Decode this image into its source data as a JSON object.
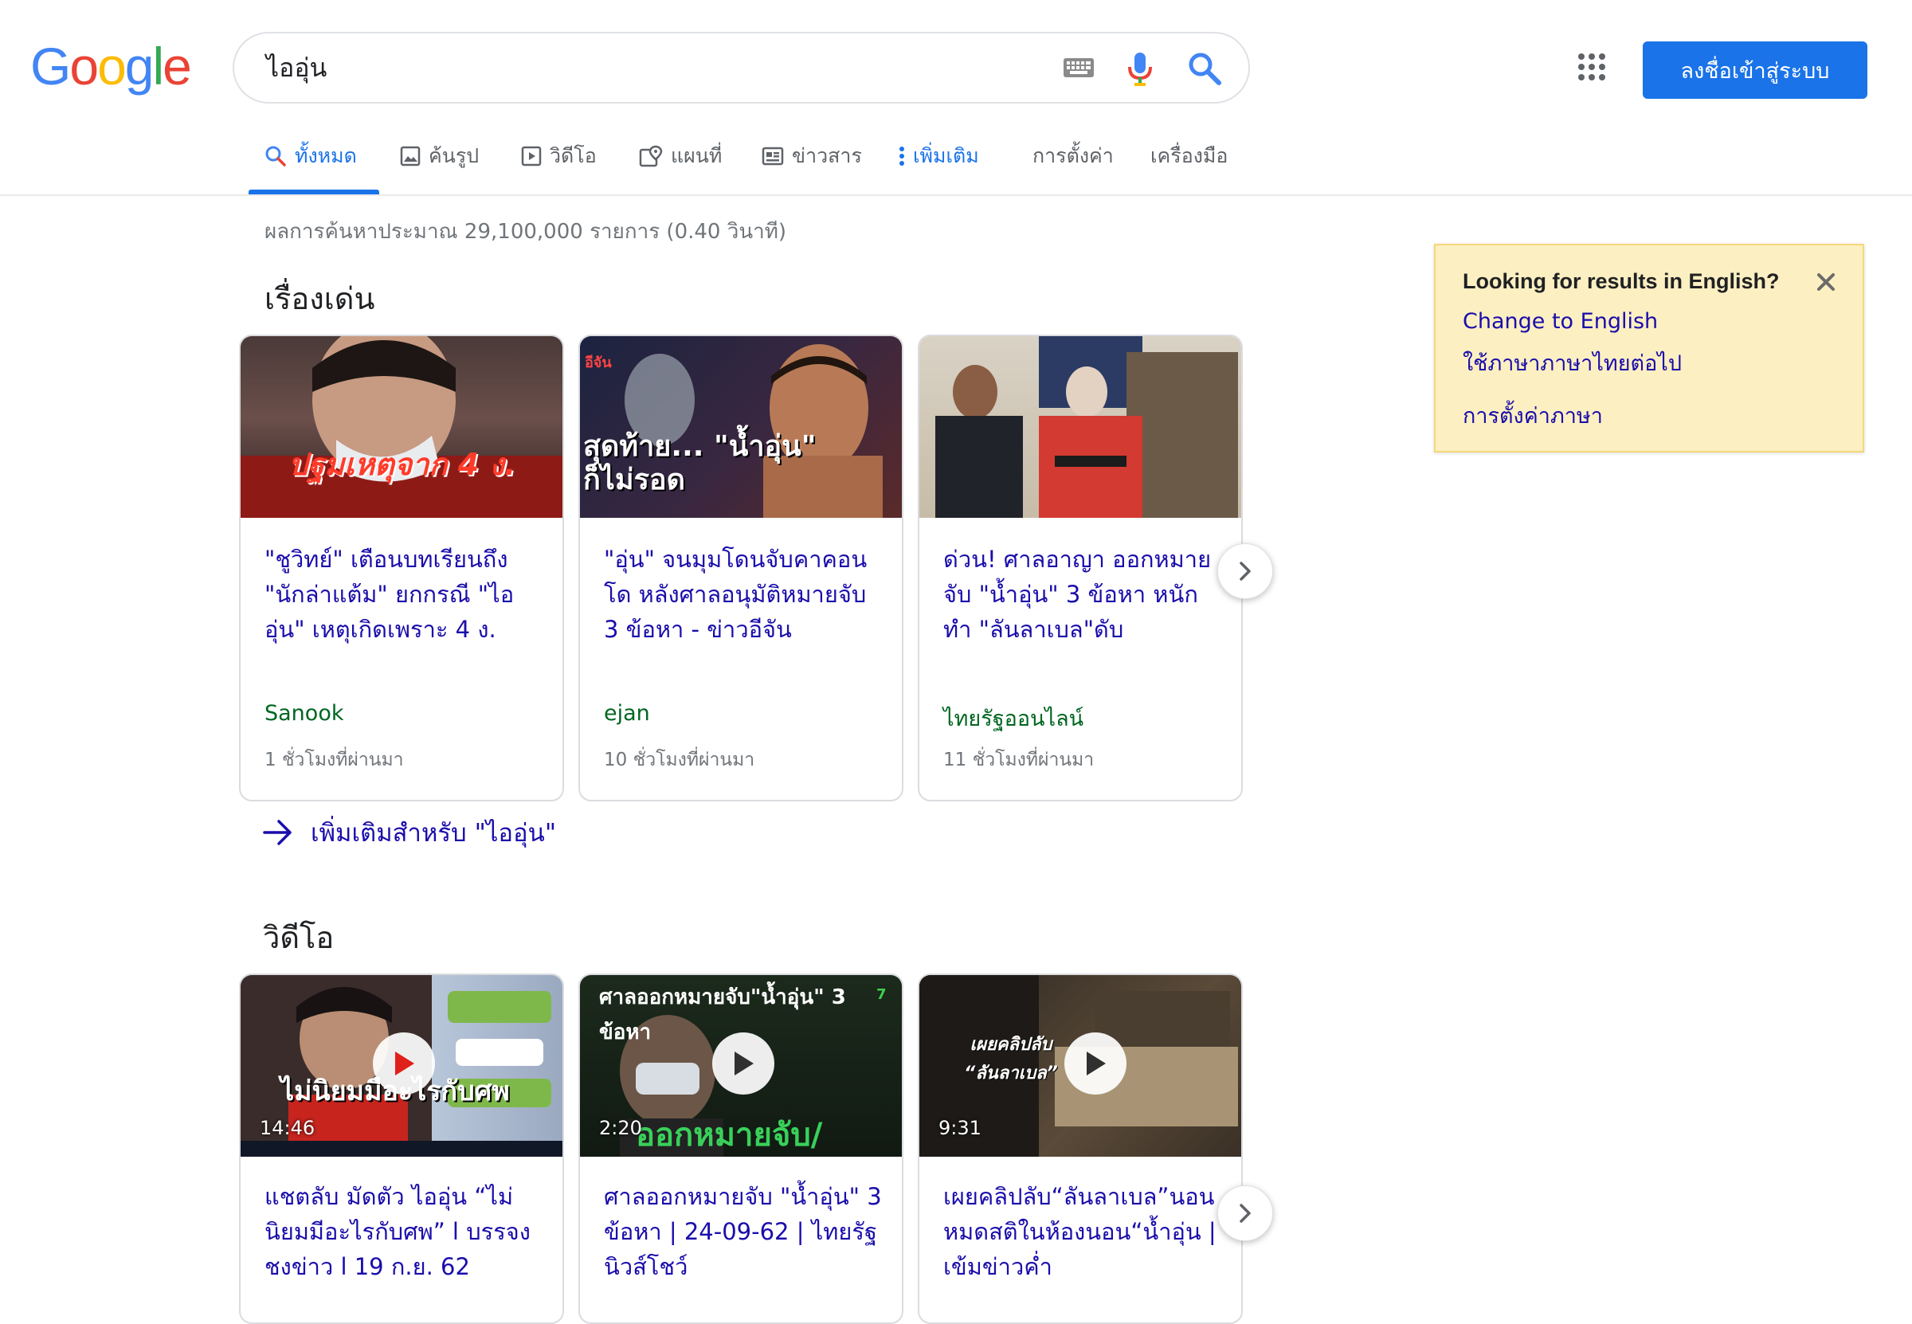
{
  "search": {
    "query": "ไออุ่น"
  },
  "logo": {
    "letters": [
      "G",
      "o",
      "o",
      "g",
      "l",
      "e"
    ],
    "colors": [
      "#4285F4",
      "#EA4335",
      "#FBBC05",
      "#4285F4",
      "#34A853",
      "#EA4335"
    ]
  },
  "header": {
    "signin_label": "ลงชื่อเข้าสู่ระบบ"
  },
  "tabs": [
    {
      "label": "ทั้งหมด",
      "icon": "search-icon",
      "active": true
    },
    {
      "label": "ค้นรูป",
      "icon": "image-icon"
    },
    {
      "label": "วิดีโอ",
      "icon": "video-icon"
    },
    {
      "label": "แผนที่",
      "icon": "map-icon"
    },
    {
      "label": "ข่าวสาร",
      "icon": "news-icon"
    },
    {
      "label": "เพิ่มเติม",
      "icon": "more-vert-icon"
    },
    {
      "label": "การตั้งค่า"
    },
    {
      "label": "เครื่องมือ"
    }
  ],
  "results_stats": "ผลการค้นหาประมาณ 29,100,000 รายการ (0.40 วินาที)",
  "top_stories": {
    "heading": "เรื่องเด่น",
    "cards": [
      {
        "thumb_text": "ปฐมเหตุจาก 4 ง.",
        "title": "\"ชูวิทย์\" เตือนบทเรียนถึง \"นักล่าแต้ม\" ยกกรณี \"ไออุ่น\" เหตุเกิดเพราะ 4 ง.",
        "source": "Sanook",
        "time": "1 ชั่วโมงที่ผ่านมา"
      },
      {
        "thumb_text": "สุดท้าย... \"น้ำอุ่น\" ก็ไม่รอด",
        "title": "\"อุ่น\" จนมุมโดนจับคาคอนโด หลังศาลอนุมัติหมายจับ 3 ข้อหา - ข่าวอีจัน",
        "source": "ejan",
        "time": "10 ชั่วโมงที่ผ่านมา"
      },
      {
        "thumb_text": "",
        "title": "ด่วน! ศาลอาญา ออกหมายจับ \"น้ำอุ่น\" 3 ข้อหา หนักทำ \"ลันลาเบล\"ดับ",
        "source": "ไทยรัฐออนไลน์",
        "time": "11 ชั่วโมงที่ผ่านมา"
      }
    ],
    "more_label": "เพิ่มเติมสำหรับ \"ไออุ่น\""
  },
  "videos": {
    "heading": "วิดีโอ",
    "cards": [
      {
        "thumb_text": "ไม่นิยมมือะไรกับศพ",
        "duration": "14:46",
        "title": "แชตลับ มัดตัว ไออุ่น “ไม่นิยมมีอะไรกับศพ” l บรรจงชงข่าว l 19 ก.ย. 62"
      },
      {
        "thumb_text": "ศาลออกหมายจับ\"น้ำอุ่น\" 3 ข้อหา",
        "thumb_text2": "ออกหมายจับ/",
        "duration": "2:20",
        "title": "ศาลออกหมายจับ \"น้ำอุ่น\" 3 ข้อหา | 24-09-62 | ไทยรัฐนิวส์โชว์"
      },
      {
        "thumb_text": "เผยคลิปลับ “ลันลาเบล”",
        "duration": "9:31",
        "title": "เผยคลิปลับ“ลันลาเบล”นอนหมดสติในห้องนอน“น้ำอุ่น | เข้มข่าวค่ำ"
      }
    ]
  },
  "language_prompt": {
    "title": "Looking for results in English?",
    "change_link": "Change to English",
    "keep_link": "ใช้ภาษาภาษาไทยต่อไป",
    "settings_link": "การตั้งค่าภาษา"
  }
}
